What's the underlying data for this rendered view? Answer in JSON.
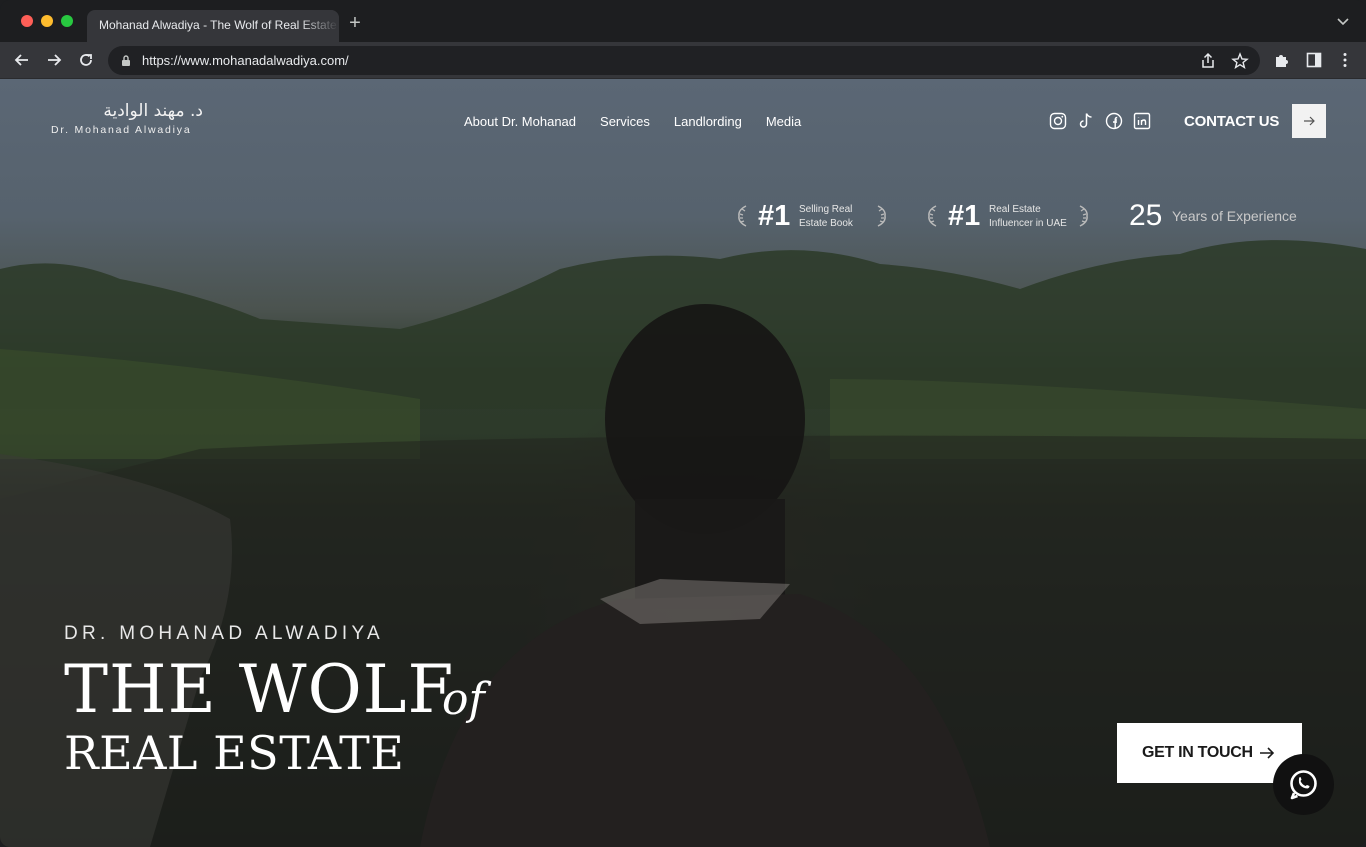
{
  "browser": {
    "tab_title": "Mohanad Alwadiya - The Wolf of Real Estate",
    "url": "https://www.mohanadalwadiya.com/"
  },
  "site": {
    "logo_arabic": "د. مهند الوادية",
    "logo_english": "Dr. Mohanad Alwadiya",
    "nav": [
      "About Dr. Mohanad",
      "Services",
      "Landlording",
      "Media"
    ],
    "social_icons": [
      "instagram-icon",
      "tiktok-icon",
      "facebook-icon",
      "linkedin-icon"
    ],
    "contact_label": "CONTACT US"
  },
  "badges": [
    {
      "num": "#1",
      "line1": "Selling Real",
      "line2": "Estate Book"
    },
    {
      "num": "#1",
      "line1": "Real Estate",
      "line2": "Influencer in UAE"
    }
  ],
  "experience": {
    "num": "25",
    "label": "Years of Experience"
  },
  "hero": {
    "subtitle": "DR. MOHANAD ALWADIYA",
    "title_line1": "THE WOLF",
    "title_of": "of",
    "title_line2": "REAL ESTATE",
    "cta_label": "GET IN TOUCH"
  },
  "colors": {
    "chrome_dark": "#1d1e20",
    "chrome_toolbar": "#35363a",
    "cta_bg": "#ffffff"
  }
}
